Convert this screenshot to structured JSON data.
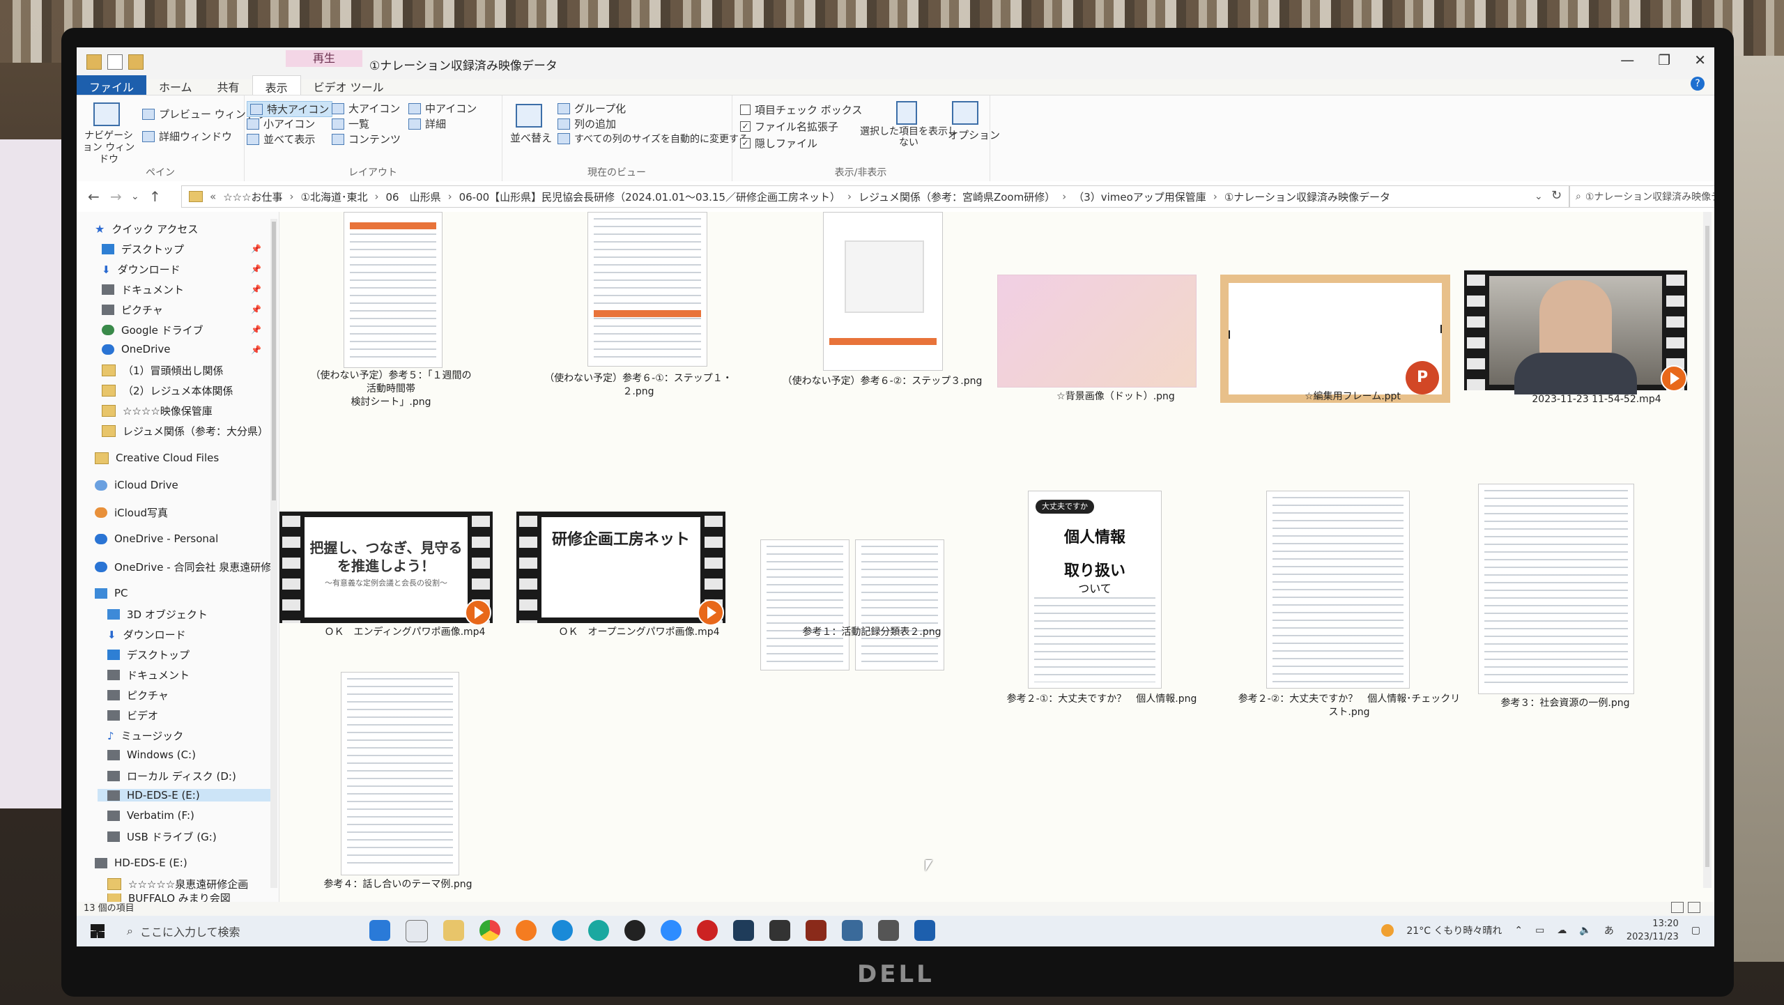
{
  "window": {
    "context_tab": "再生",
    "title": "①ナレーション収録済み映像データ"
  },
  "tabs": {
    "file": "ファイル",
    "home": "ホーム",
    "share": "共有",
    "view": "表示",
    "video_tools": "ビデオ ツール"
  },
  "ribbon": {
    "pane": {
      "nav_pane": "ナビゲーション ウィンドウ",
      "preview": "プレビュー ウィンドウ",
      "details": "詳細ウィンドウ",
      "label": "ペイン"
    },
    "layout": {
      "xl_icons": "特大アイコン",
      "large_icons": "大アイコン",
      "medium_icons": "中アイコン",
      "small_icons": "小アイコン",
      "list": "一覧",
      "details": "詳細",
      "tiles": "並べて表示",
      "content": "コンテンツ",
      "label": "レイアウト"
    },
    "current_view": {
      "sort": "並べ替え",
      "group_by": "グループ化",
      "add_columns": "列の追加",
      "fit_columns": "すべての列のサイズを自動的に変更する",
      "label": "現在のビュー"
    },
    "show_hide": {
      "item_checkboxes": "項目チェック ボックス",
      "file_extensions": "ファイル名拡張子",
      "hidden_items": "隠しファイル",
      "hide_selected": "選択した項目を表示しない",
      "label": "表示/非表示"
    },
    "options": "オプション"
  },
  "address": {
    "path": [
      "☆☆☆お仕事",
      "①北海道･東北",
      "06　山形県",
      "06-00【山形県】民児協会長研修（2024.01.01～03.15／研修企画工房ネット）",
      "レジュメ関係（参考：宮崎県Zoom研修）",
      "（3）vimeoアップ用保管庫",
      "①ナレーション収録済み映像データ"
    ],
    "search_placeholder": "①ナレーション収録済み映像デ..."
  },
  "nav_pane": {
    "quick_access": "クイック アクセス",
    "desktop": "デスクトップ",
    "downloads": "ダウンロード",
    "documents": "ドキュメント",
    "pictures": "ピクチャ",
    "google_drive": "Google ドライブ",
    "onedrive": "OneDrive",
    "folder1": "（1）冒頭傾出し関係",
    "folder2": "（2）レジュメ本体関係",
    "folder3": "☆☆☆☆映像保管庫",
    "folder4": "レジュメ関係（参考：大分県）",
    "creative_cloud": "Creative Cloud Files",
    "icloud_drive": "iCloud Drive",
    "icloud_photos": "iCloud写真",
    "onedrive_personal": "OneDrive - Personal",
    "onedrive_corp": "OneDrive - 合同会社 泉恵遠研修",
    "pc": "PC",
    "objects3d": "3D オブジェクト",
    "pc_downloads": "ダウンロード",
    "pc_desktop": "デスクトップ",
    "pc_documents": "ドキュメント",
    "pc_pictures": "ピクチャ",
    "pc_videos": "ビデオ",
    "pc_music": "ミュージック",
    "drive_c": "Windows (C:)",
    "drive_d": "ローカル ディスク (D:)",
    "drive_e": "HD-EDS-E (E:)",
    "drive_f": "Verbatim (F:)",
    "drive_g": "USB ドライブ (G:)",
    "drive_e2": "HD-EDS-E (E:)",
    "folder5": "☆☆☆☆☆泉恵遠研修企画",
    "folder6": "BUFFALO みまり会図"
  },
  "files": {
    "f1": [
      "（使わない予定）参考５：「１週間の活動時間帯",
      "検討シート」.png"
    ],
    "f2": "（使わない予定）参考６-①：ステップ１・２.png",
    "f3": "（使わない予定）参考６-②：ステップ３.png",
    "f4": "☆背景画像（ドット）.png",
    "f5": "☆編集用フレーム.ppt",
    "f6": "2023-11-23 11-54-52.mp4",
    "f7": "ＯＫ　エンディングパワポ画像.mp4",
    "f7_line1": "把握し、つなぎ、見守る",
    "f7_line2": "を推進しよう！",
    "f7_line3": "～有意義な定例会議と会長の役割～",
    "f8": "ＯＫ　オープニングパワポ画像.mp4",
    "f8_text": "研修企画工房ネット",
    "f9": "参考１：活動記録分類表２.png",
    "f10": "参考２-①：大丈夫ですか？　個人情報.png",
    "f10_t1": "大丈夫ですか",
    "f10_t2": "個人情報",
    "f10_t3": "取り扱い",
    "f10_t4": "ついて",
    "f11": [
      "参考２-②：大丈夫ですか？　個人情報･チェックリ",
      "スト.png"
    ],
    "f12": "参考３：社会資源の一例.png",
    "f13": "参考４：話し合いのテーマ例.png"
  },
  "status": "13 個の項目",
  "taskbar": {
    "search_placeholder": "ここに入力して検索",
    "weather": "21°C  くもり時々晴れ",
    "ime": "あ",
    "time": "13:20",
    "date": "2023/11/23"
  },
  "monitor_brand": "DELL"
}
